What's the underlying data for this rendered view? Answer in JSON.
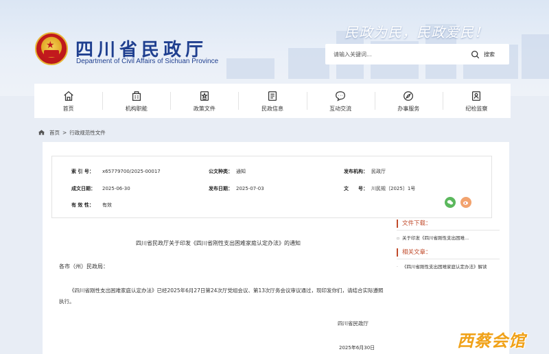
{
  "header": {
    "title": "四川省民政厅",
    "subtitle": "Department of Civil Affairs of Sichuan Province",
    "slogan": "民政为民，民政爱民！",
    "search": {
      "placeholder": "请输入关键词...",
      "button_label": "搜索"
    }
  },
  "nav": {
    "items": [
      {
        "label": "首页",
        "icon": "home-icon"
      },
      {
        "label": "机构职能",
        "icon": "building-icon"
      },
      {
        "label": "政策文件",
        "icon": "document-star-icon"
      },
      {
        "label": "民政信息",
        "icon": "info-list-icon"
      },
      {
        "label": "互动交流",
        "icon": "chat-bubble-icon"
      },
      {
        "label": "办事服务",
        "icon": "compass-icon"
      },
      {
        "label": "纪检监察",
        "icon": "badge-icon"
      }
    ]
  },
  "breadcrumb": {
    "home": "首页",
    "separator": ">",
    "current": "行政规范性文件"
  },
  "meta": {
    "index_label": "索 引 号：",
    "index_value": "x65779700/2025-00017",
    "doc_type_label": "公文种类：",
    "doc_type_value": "通知",
    "issuer_label": "发布机构：",
    "issuer_value": "民政厅",
    "created_label": "成文日期：",
    "created_value": "2025-06-30",
    "published_label": "发布日期：",
    "published_value": "2025-07-03",
    "doc_no_label": "文　　号：",
    "doc_no_value": "川民规〔2025〕1号",
    "validity_label": "有 效 性：",
    "validity_value": "有效"
  },
  "article": {
    "title": "四川省民政厅关于印发《四川省刚性支出困难家庭认定办法》的通知",
    "greeting": "各市（州）民政局：",
    "body": "《四川省刚性支出困难家庭认定办法》已经2025年6月27日第24次厅党组会议、第13次厅务会议审议通过，现印发你们，请结合实际遵照执行。",
    "signature": "四川省民政厅",
    "date": "2025年6月30日"
  },
  "sidebar": {
    "download_title": "文件下载：",
    "download_item": "关于印发《四川省刚性支出困难...",
    "related_title": "相关文章：",
    "related_item": "《四川省刚性支出困难家庭认定办法》解读",
    "bullet": "·"
  },
  "watermark": "西蔡会馆",
  "colors": {
    "brand_blue": "#1f3f8f",
    "accent_red": "#c04a2a",
    "wechat_green": "#5bb85d",
    "weibo_orange": "#f2a36e",
    "watermark_orange": "#f0a21a"
  }
}
